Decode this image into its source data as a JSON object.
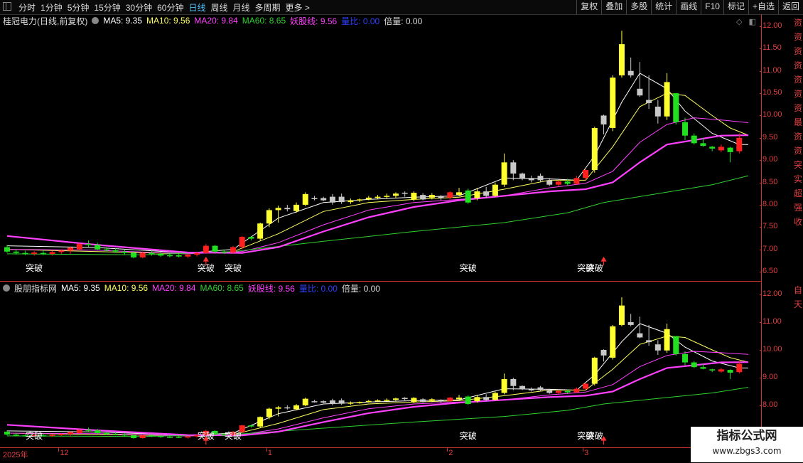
{
  "toolbar": {
    "left": [
      "分时",
      "1分钟",
      "5分钟",
      "15分钟",
      "30分钟",
      "60分钟",
      "日线",
      "周线",
      "月线",
      "多周期",
      "更多 >"
    ],
    "active_index": 6,
    "right": [
      "复权",
      "叠加",
      "多股",
      "统计",
      "画线",
      "F10",
      "标记",
      "+自选",
      "返回"
    ]
  },
  "main_legend": {
    "ticker": "桂冠电力(日线,前复权)",
    "ma5": "MA5: 9.35",
    "ma10": "MA10: 9.56",
    "ma20": "MA20: 9.84",
    "ma60": "MA60: 8.65",
    "yao": "妖股线: 9.56",
    "liangbi": "量比: 0.00",
    "beiliang": "倍量: 0.00"
  },
  "sub_legend": {
    "ticker": "股朋指标网",
    "ma5": "MA5: 9.35",
    "ma10": "MA10: 9.56",
    "ma20": "MA20: 9.84",
    "ma60": "MA60: 8.65",
    "yao": "妖股线: 9.56",
    "liangbi": "量比: 0.00",
    "beiliang": "倍量: 0.00"
  },
  "colors": {
    "up": "#ff2020",
    "down": "#20e020",
    "yellow": "#ffff30",
    "grey": "#c8c8c8",
    "ma5": "#ffffff",
    "ma10": "#ffff60",
    "ma20": "#ff40ff",
    "ma60": "#30d030",
    "yao": "#ff40ff",
    "liangbi": "#3040ff"
  },
  "main_axis": [
    "12.00",
    "11.50",
    "11.00",
    "10.50",
    "10.00",
    "9.50",
    "9.00",
    "8.50",
    "8.00",
    "7.50",
    "7.00",
    "6.50"
  ],
  "sub_axis": [
    "12.00",
    "11.00",
    "10.00",
    "9.00",
    "8.00"
  ],
  "side_text_main": "资资资资资资资最资资突实超强收",
  "side_text_sub": "自天",
  "date_axis": [
    "2025年",
    "12",
    "1",
    "2",
    "3"
  ],
  "signal_label": "突破",
  "watermark": {
    "title": "指标公式网",
    "url": "www.zbgs3.com"
  },
  "chart_data": {
    "type": "candlestick",
    "title": "",
    "ylim": [
      6.3,
      12.1
    ],
    "grid": false,
    "candles": [
      {
        "o": 7.05,
        "h": 7.1,
        "l": 6.92,
        "c": 6.95,
        "s": "g"
      },
      {
        "o": 6.95,
        "h": 7.0,
        "l": 6.88,
        "c": 6.92,
        "s": "g"
      },
      {
        "o": 6.92,
        "h": 6.97,
        "l": 6.87,
        "c": 6.9,
        "s": "g"
      },
      {
        "o": 6.9,
        "h": 6.96,
        "l": 6.86,
        "c": 6.93,
        "s": "r"
      },
      {
        "o": 6.92,
        "h": 6.98,
        "l": 6.87,
        "c": 6.9,
        "s": "g"
      },
      {
        "o": 6.9,
        "h": 6.97,
        "l": 6.86,
        "c": 6.94,
        "s": "r"
      },
      {
        "o": 6.94,
        "h": 7.0,
        "l": 6.9,
        "c": 6.97,
        "s": "r"
      },
      {
        "o": 6.97,
        "h": 7.06,
        "l": 6.9,
        "c": 7.04,
        "s": "r"
      },
      {
        "o": 7.0,
        "h": 7.15,
        "l": 6.98,
        "c": 7.12,
        "s": "r"
      },
      {
        "o": 7.12,
        "h": 7.2,
        "l": 7.05,
        "c": 7.1,
        "s": "g"
      },
      {
        "o": 7.1,
        "h": 7.15,
        "l": 6.98,
        "c": 7.0,
        "s": "g"
      },
      {
        "o": 7.0,
        "h": 7.05,
        "l": 6.94,
        "c": 6.98,
        "s": "g"
      },
      {
        "o": 6.98,
        "h": 7.03,
        "l": 6.92,
        "c": 6.95,
        "s": "g"
      },
      {
        "o": 6.95,
        "h": 7.0,
        "l": 6.88,
        "c": 6.92,
        "s": "g"
      },
      {
        "o": 6.92,
        "h": 6.96,
        "l": 6.8,
        "c": 6.82,
        "s": "g"
      },
      {
        "o": 6.82,
        "h": 6.95,
        "l": 6.8,
        "c": 6.92,
        "s": "r"
      },
      {
        "o": 6.92,
        "h": 6.97,
        "l": 6.86,
        "c": 6.9,
        "s": "g"
      },
      {
        "o": 6.9,
        "h": 6.95,
        "l": 6.83,
        "c": 6.86,
        "s": "g"
      },
      {
        "o": 6.86,
        "h": 6.92,
        "l": 6.82,
        "c": 6.87,
        "s": "g"
      },
      {
        "o": 6.87,
        "h": 6.92,
        "l": 6.82,
        "c": 6.84,
        "s": "g"
      },
      {
        "o": 6.84,
        "h": 6.9,
        "l": 6.8,
        "c": 6.88,
        "s": "r"
      },
      {
        "o": 6.88,
        "h": 6.95,
        "l": 6.84,
        "c": 6.92,
        "s": "r"
      },
      {
        "o": 6.92,
        "h": 7.12,
        "l": 6.9,
        "c": 7.08,
        "s": "r"
      },
      {
        "o": 7.08,
        "h": 7.1,
        "l": 6.92,
        "c": 6.95,
        "s": "g"
      },
      {
        "o": 6.95,
        "h": 7.0,
        "l": 6.9,
        "c": 6.93,
        "s": "g"
      },
      {
        "o": 6.93,
        "h": 7.08,
        "l": 6.9,
        "c": 7.05,
        "s": "r"
      },
      {
        "o": 7.05,
        "h": 7.3,
        "l": 7.0,
        "c": 7.28,
        "s": "r"
      },
      {
        "o": 7.28,
        "h": 7.3,
        "l": 7.2,
        "c": 7.24,
        "s": "g"
      },
      {
        "o": 7.24,
        "h": 7.6,
        "l": 7.2,
        "c": 7.58,
        "s": "y"
      },
      {
        "o": 7.58,
        "h": 7.92,
        "l": 7.5,
        "c": 7.88,
        "s": "y"
      },
      {
        "o": 7.88,
        "h": 7.98,
        "l": 7.6,
        "c": 7.93,
        "s": "y"
      },
      {
        "o": 7.93,
        "h": 8.0,
        "l": 7.85,
        "c": 7.9,
        "s": "w"
      },
      {
        "o": 7.86,
        "h": 8.05,
        "l": 7.82,
        "c": 8.0,
        "s": "y"
      },
      {
        "o": 8.0,
        "h": 8.28,
        "l": 7.97,
        "c": 8.24,
        "s": "y"
      },
      {
        "o": 8.14,
        "h": 8.2,
        "l": 8.1,
        "c": 8.15,
        "s": "w"
      },
      {
        "o": 8.15,
        "h": 8.18,
        "l": 8.08,
        "c": 8.1,
        "s": "w"
      },
      {
        "o": 8.05,
        "h": 8.24,
        "l": 8.0,
        "c": 8.18,
        "s": "w"
      },
      {
        "o": 8.18,
        "h": 8.25,
        "l": 8.02,
        "c": 8.06,
        "s": "w"
      },
      {
        "o": 8.06,
        "h": 8.14,
        "l": 8.02,
        "c": 8.1,
        "s": "y"
      },
      {
        "o": 8.1,
        "h": 8.14,
        "l": 8.06,
        "c": 8.12,
        "s": "y"
      },
      {
        "o": 8.12,
        "h": 8.2,
        "l": 8.1,
        "c": 8.16,
        "s": "y"
      },
      {
        "o": 8.16,
        "h": 8.22,
        "l": 8.12,
        "c": 8.18,
        "s": "y"
      },
      {
        "o": 8.18,
        "h": 8.25,
        "l": 8.14,
        "c": 8.2,
        "s": "y"
      },
      {
        "o": 8.2,
        "h": 8.28,
        "l": 8.15,
        "c": 8.25,
        "s": "y"
      },
      {
        "o": 8.25,
        "h": 8.3,
        "l": 8.18,
        "c": 8.27,
        "s": "w"
      },
      {
        "o": 8.27,
        "h": 8.3,
        "l": 8.08,
        "c": 8.12,
        "s": "y"
      },
      {
        "o": 8.12,
        "h": 8.26,
        "l": 8.1,
        "c": 8.22,
        "s": "w"
      },
      {
        "o": 8.22,
        "h": 8.26,
        "l": 8.12,
        "c": 8.16,
        "s": "y"
      },
      {
        "o": 8.15,
        "h": 8.22,
        "l": 8.1,
        "c": 8.18,
        "s": "w"
      },
      {
        "o": 8.16,
        "h": 8.3,
        "l": 8.12,
        "c": 8.28,
        "s": "r"
      },
      {
        "o": 8.28,
        "h": 8.38,
        "l": 8.2,
        "c": 8.22,
        "s": "y"
      },
      {
        "o": 8.32,
        "h": 8.36,
        "l": 8.02,
        "c": 8.05,
        "s": "g"
      },
      {
        "o": 8.15,
        "h": 8.38,
        "l": 8.1,
        "c": 8.3,
        "s": "y"
      },
      {
        "o": 8.3,
        "h": 8.4,
        "l": 8.15,
        "c": 8.2,
        "s": "w"
      },
      {
        "o": 8.2,
        "h": 8.5,
        "l": 8.18,
        "c": 8.45,
        "s": "y"
      },
      {
        "o": 8.45,
        "h": 9.15,
        "l": 8.4,
        "c": 8.95,
        "s": "y"
      },
      {
        "o": 8.95,
        "h": 9.0,
        "l": 8.55,
        "c": 8.7,
        "s": "w"
      },
      {
        "o": 8.7,
        "h": 8.72,
        "l": 8.55,
        "c": 8.58,
        "s": "w"
      },
      {
        "o": 8.58,
        "h": 8.65,
        "l": 8.5,
        "c": 8.55,
        "s": "w"
      },
      {
        "o": 8.55,
        "h": 8.7,
        "l": 8.5,
        "c": 8.65,
        "s": "w"
      },
      {
        "o": 8.55,
        "h": 8.6,
        "l": 8.42,
        "c": 8.45,
        "s": "w"
      },
      {
        "o": 8.45,
        "h": 8.55,
        "l": 8.4,
        "c": 8.52,
        "s": "r"
      },
      {
        "o": 8.52,
        "h": 8.58,
        "l": 8.43,
        "c": 8.47,
        "s": "g"
      },
      {
        "o": 8.47,
        "h": 8.65,
        "l": 8.45,
        "c": 8.6,
        "s": "r"
      },
      {
        "o": 8.6,
        "h": 8.82,
        "l": 8.55,
        "c": 8.78,
        "s": "r"
      },
      {
        "o": 8.78,
        "h": 9.75,
        "l": 8.72,
        "c": 9.72,
        "s": "y"
      },
      {
        "o": 9.8,
        "h": 10.02,
        "l": 9.58,
        "c": 10.0,
        "s": "w"
      },
      {
        "o": 9.72,
        "h": 10.9,
        "l": 9.65,
        "c": 10.85,
        "s": "y"
      },
      {
        "o": 10.9,
        "h": 11.9,
        "l": 10.85,
        "c": 11.6,
        "s": "y"
      },
      {
        "o": 11.0,
        "h": 11.3,
        "l": 10.85,
        "c": 10.9,
        "s": "w"
      },
      {
        "o": 10.6,
        "h": 11.2,
        "l": 10.42,
        "c": 10.45,
        "s": "w"
      },
      {
        "o": 10.35,
        "h": 10.9,
        "l": 10.15,
        "c": 10.28,
        "s": "w"
      },
      {
        "o": 10.2,
        "h": 10.35,
        "l": 9.82,
        "c": 9.98,
        "s": "w"
      },
      {
        "o": 9.98,
        "h": 10.95,
        "l": 9.9,
        "c": 10.75,
        "s": "y"
      },
      {
        "o": 10.5,
        "h": 10.5,
        "l": 9.8,
        "c": 9.85,
        "s": "g"
      },
      {
        "o": 9.85,
        "h": 9.95,
        "l": 9.45,
        "c": 9.55,
        "s": "g"
      },
      {
        "o": 9.55,
        "h": 9.6,
        "l": 9.35,
        "c": 9.38,
        "s": "g"
      },
      {
        "o": 9.38,
        "h": 9.5,
        "l": 9.3,
        "c": 9.32,
        "s": "g"
      },
      {
        "o": 9.3,
        "h": 9.32,
        "l": 9.2,
        "c": 9.26,
        "s": "g"
      },
      {
        "o": 9.22,
        "h": 9.35,
        "l": 9.18,
        "c": 9.3,
        "s": "r"
      },
      {
        "o": 9.28,
        "h": 9.3,
        "l": 8.95,
        "c": 9.18,
        "s": "g"
      },
      {
        "o": 9.2,
        "h": 9.6,
        "l": 9.15,
        "c": 9.5,
        "s": "r"
      }
    ],
    "ma_series": [
      {
        "name": "MA5",
        "values": [
          [
            0,
            7.08
          ],
          [
            10,
            7.04
          ],
          [
            20,
            6.92
          ],
          [
            25,
            7.0
          ],
          [
            30,
            7.7
          ],
          [
            35,
            8.05
          ],
          [
            40,
            8.12
          ],
          [
            45,
            8.17
          ],
          [
            50,
            8.2
          ],
          [
            55,
            8.6
          ],
          [
            60,
            8.58
          ],
          [
            63,
            8.55
          ],
          [
            65,
            9.1
          ],
          [
            68,
            10.3
          ],
          [
            70,
            10.95
          ],
          [
            73,
            10.6
          ],
          [
            75,
            10.1
          ],
          [
            78,
            9.6
          ],
          [
            81,
            9.35
          ],
          [
            82,
            9.35
          ]
        ]
      },
      {
        "name": "MA10",
        "values": [
          [
            0,
            7.0
          ],
          [
            20,
            6.9
          ],
          [
            25,
            6.95
          ],
          [
            30,
            7.35
          ],
          [
            35,
            7.85
          ],
          [
            40,
            8.05
          ],
          [
            45,
            8.12
          ],
          [
            50,
            8.17
          ],
          [
            55,
            8.35
          ],
          [
            60,
            8.55
          ],
          [
            64,
            8.55
          ],
          [
            67,
            9.3
          ],
          [
            70,
            10.2
          ],
          [
            73,
            10.5
          ],
          [
            75,
            10.45
          ],
          [
            78,
            10.0
          ],
          [
            80,
            9.72
          ],
          [
            82,
            9.56
          ]
        ]
      },
      {
        "name": "MA20",
        "values": [
          [
            0,
            7.0
          ],
          [
            10,
            6.98
          ],
          [
            20,
            6.9
          ],
          [
            26,
            6.95
          ],
          [
            30,
            7.15
          ],
          [
            35,
            7.55
          ],
          [
            40,
            7.88
          ],
          [
            45,
            8.05
          ],
          [
            50,
            8.12
          ],
          [
            55,
            8.2
          ],
          [
            60,
            8.38
          ],
          [
            64,
            8.48
          ],
          [
            67,
            8.75
          ],
          [
            70,
            9.4
          ],
          [
            73,
            9.8
          ],
          [
            76,
            9.95
          ],
          [
            79,
            9.9
          ],
          [
            82,
            9.84
          ]
        ]
      },
      {
        "name": "MA60",
        "values": [
          [
            0,
            6.9
          ],
          [
            15,
            6.88
          ],
          [
            25,
            6.95
          ],
          [
            35,
            7.18
          ],
          [
            45,
            7.4
          ],
          [
            55,
            7.6
          ],
          [
            62,
            7.82
          ],
          [
            66,
            8.05
          ],
          [
            72,
            8.25
          ],
          [
            78,
            8.45
          ],
          [
            82,
            8.65
          ]
        ]
      },
      {
        "name": "yao",
        "values": [
          [
            0,
            7.3
          ],
          [
            10,
            7.1
          ],
          [
            20,
            6.93
          ],
          [
            26,
            6.92
          ],
          [
            30,
            7.05
          ],
          [
            35,
            7.4
          ],
          [
            40,
            7.72
          ],
          [
            45,
            7.95
          ],
          [
            50,
            8.1
          ],
          [
            55,
            8.2
          ],
          [
            60,
            8.3
          ],
          [
            64,
            8.35
          ],
          [
            67,
            8.5
          ],
          [
            70,
            8.95
          ],
          [
            73,
            9.35
          ],
          [
            76,
            9.45
          ],
          [
            79,
            9.55
          ],
          [
            82,
            9.56
          ]
        ]
      }
    ],
    "signals": [
      3,
      22,
      25,
      51,
      64,
      65
    ],
    "arrows": [
      22,
      66
    ]
  }
}
